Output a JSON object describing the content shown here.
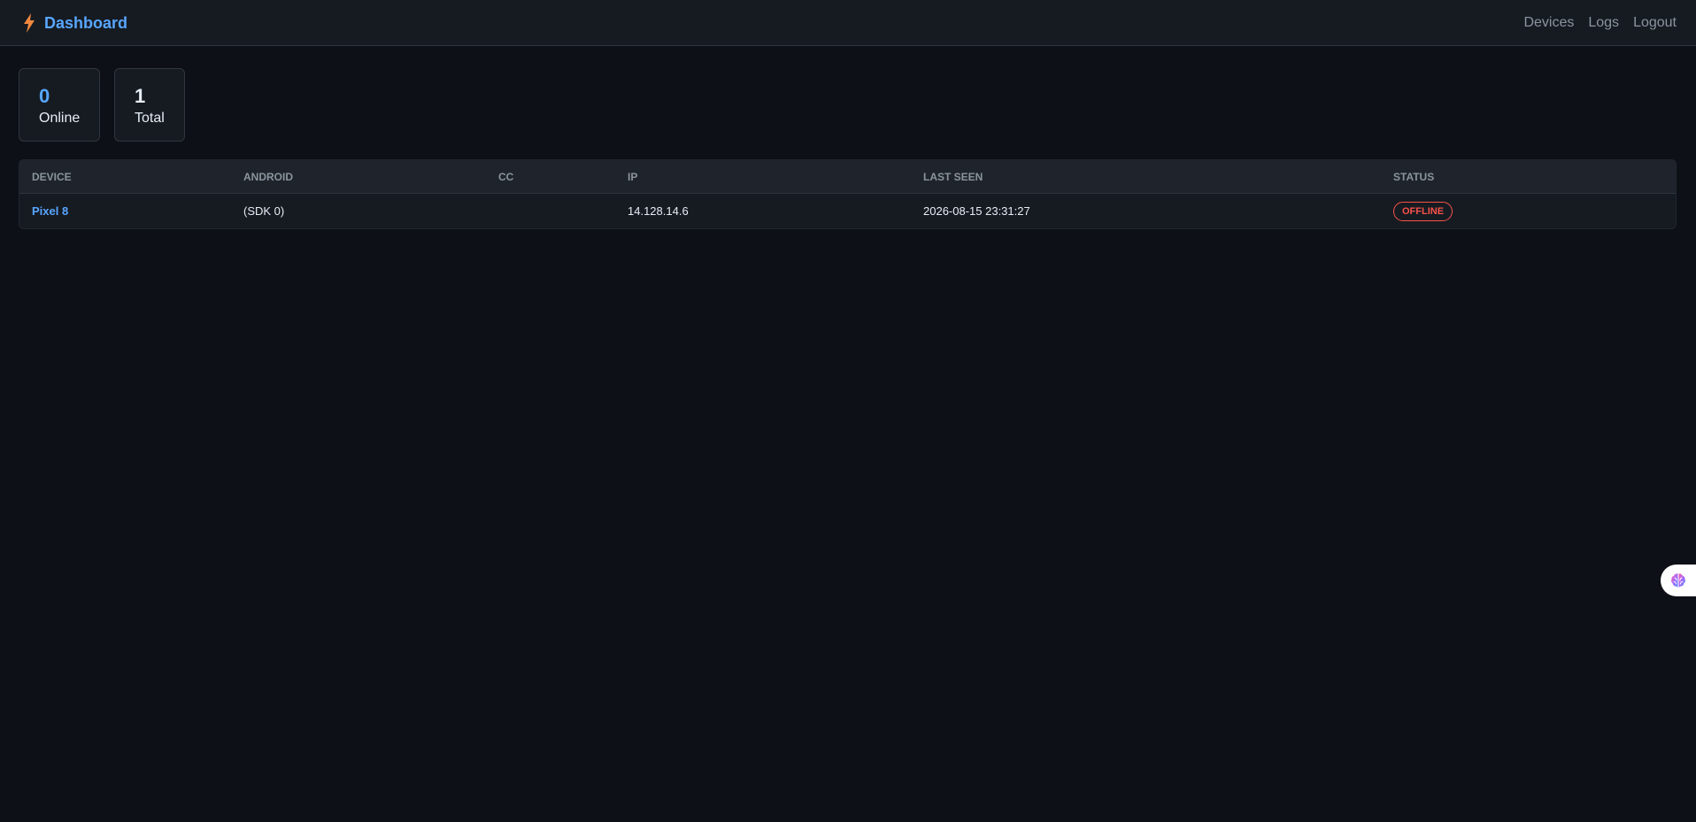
{
  "header": {
    "brand_icon": "lightning-bolt-icon",
    "title": "Dashboard",
    "nav": [
      {
        "label": "Devices"
      },
      {
        "label": "Logs"
      },
      {
        "label": "Logout"
      }
    ]
  },
  "stats": [
    {
      "value": "0",
      "label": "Online"
    },
    {
      "value": "1",
      "label": "Total"
    }
  ],
  "table": {
    "columns": [
      "DEVICE",
      "ANDROID",
      "CC",
      "IP",
      "LAST SEEN",
      "STATUS"
    ],
    "rows": [
      {
        "device": "Pixel 8",
        "android": "(SDK 0)",
        "cc": "",
        "ip": "14.128.14.6",
        "last_seen": "2026-08-15 23:31:27",
        "status": "OFFLINE"
      }
    ]
  },
  "side_widget": {
    "icon": "brain-icon"
  },
  "colors": {
    "background": "#0d1117",
    "accent": "#58a6ff",
    "offline": "#f85149",
    "bolt": "#f0883e"
  }
}
